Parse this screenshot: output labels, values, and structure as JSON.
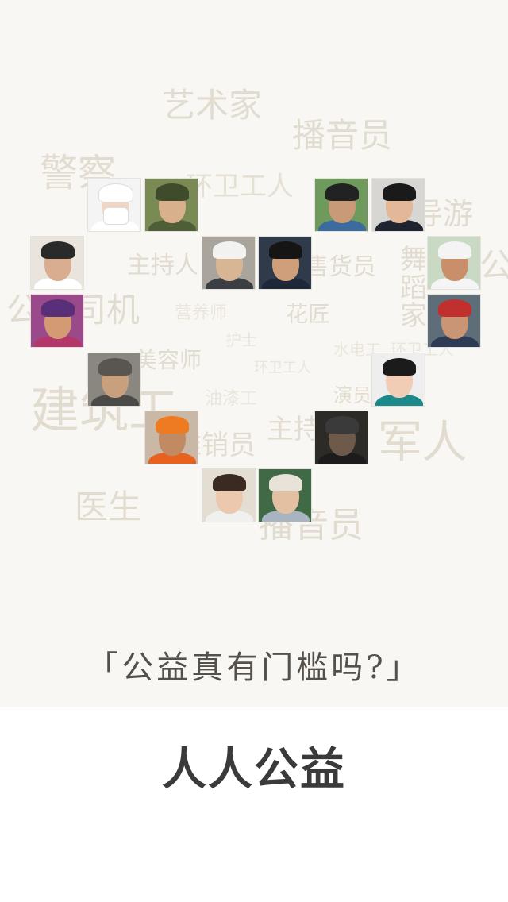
{
  "splash": {
    "background_words": [
      "艺术家",
      "播音员",
      "警察",
      "环卫工人",
      "导游",
      "主持人",
      "售货员",
      "舞蹈家",
      "公",
      "公交司机",
      "营养师",
      "花匠",
      "护士",
      "美容师",
      "水电工",
      "环卫工人",
      "环卫工人",
      "建筑工",
      "油漆工",
      "演员",
      "主持人",
      "推销员",
      "军人",
      "医生",
      "播音员"
    ],
    "portraits": [
      "Chef",
      "Soldier",
      "Young man",
      "Businessman",
      "Professor",
      "Engineer",
      "Police officer",
      "Athlete",
      "Child",
      "Worker",
      "Elderly man",
      "Receptionist",
      "Road worker",
      "Miner",
      "Student",
      "Teacher"
    ],
    "tagline": "「公益真有门槛吗?」"
  },
  "brand": {
    "title": "人人公益"
  },
  "colors": {
    "splash_background": "#f8f7f4",
    "word_color": "#e2dcd0",
    "tagline_color": "#555049",
    "brand_color": "#3a3a3a"
  }
}
